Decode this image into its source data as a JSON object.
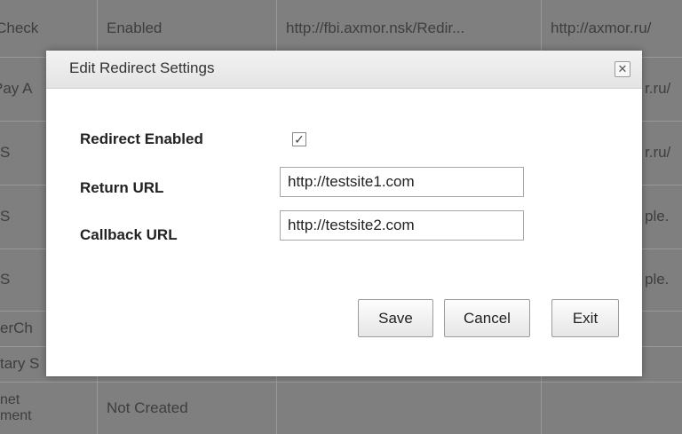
{
  "background_table": {
    "rows": [
      [
        "erCheck",
        "Enabled",
        "http://fbi.axmor.nsk/Redir...",
        "http://axmor.ru/"
      ],
      [
        "Pay A",
        "",
        "",
        "r.ru/"
      ],
      [
        "S",
        "",
        "",
        "r.ru/"
      ],
      [
        "S",
        "",
        "",
        "ple."
      ],
      [
        "S",
        "",
        "",
        "ple."
      ],
      [
        "erCh",
        "",
        "",
        ""
      ],
      [
        "tary S",
        "",
        "",
        ""
      ],
      [
        "net\nment",
        "Not Created",
        "",
        ""
      ]
    ]
  },
  "dialog": {
    "title": "Edit Redirect Settings",
    "close_glyph": "✕",
    "fields": {
      "redirect_enabled_label": "Redirect Enabled",
      "redirect_enabled_checked": true,
      "return_url_label": "Return URL",
      "return_url_value": "http://testsite1.com",
      "callback_url_label": "Callback URL",
      "callback_url_value": "http://testsite2.com"
    },
    "buttons": {
      "save": "Save",
      "cancel": "Cancel",
      "exit": "Exit"
    }
  }
}
